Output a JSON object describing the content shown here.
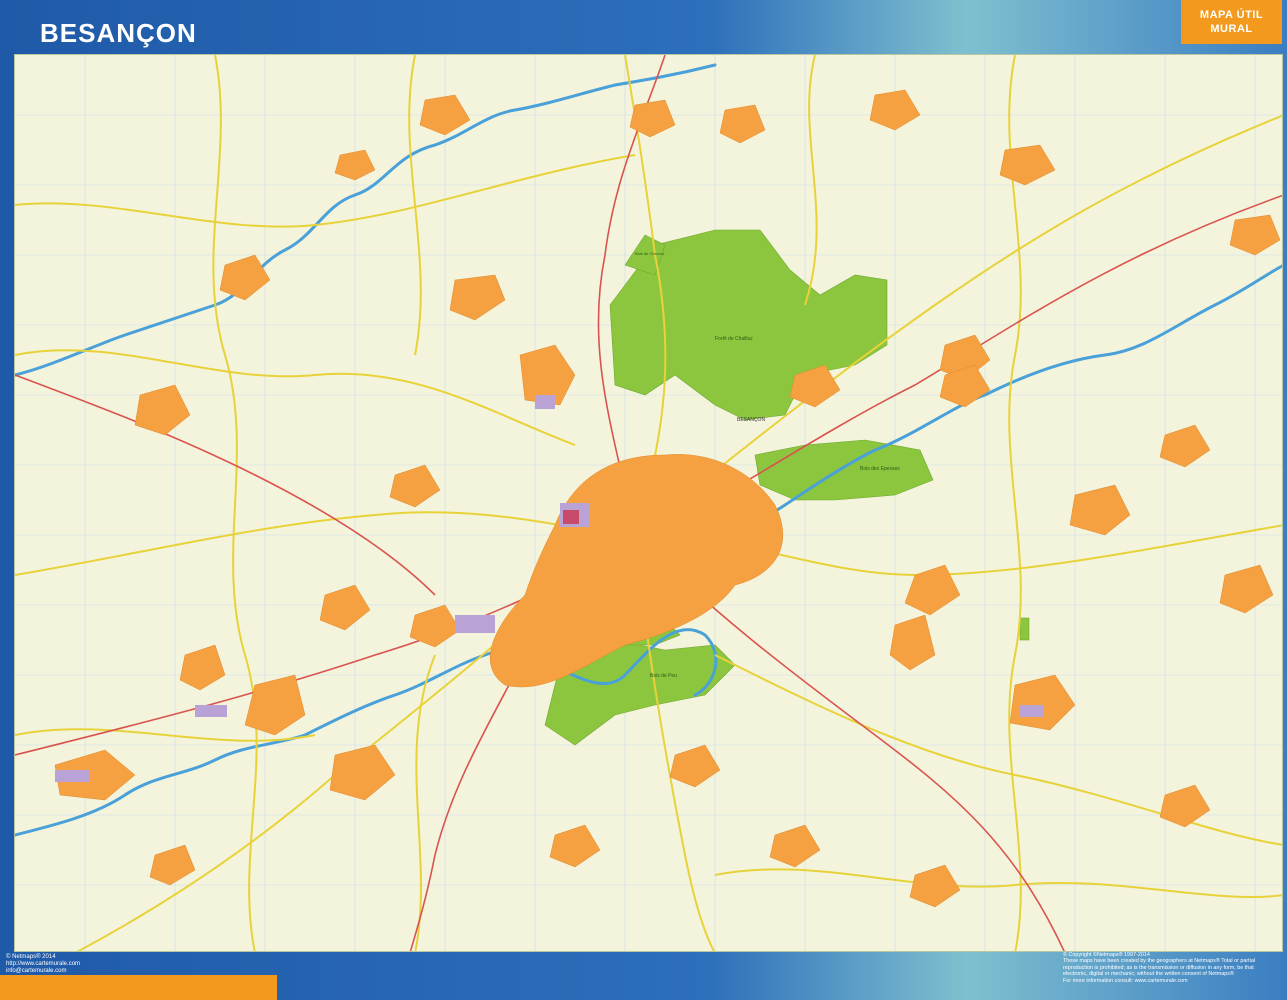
{
  "header": {
    "title": "BESANÇON"
  },
  "badge": {
    "line1": "MAPA ÚTIL",
    "line2": "MURAL"
  },
  "map": {
    "colors": {
      "background": "#f4f4dc",
      "urban": "#f5a142",
      "forest": "#8cc63f",
      "river": "#4aa0d8",
      "river_fill": "#cfe8f6",
      "main_road": "#e8d23a",
      "motorway": "#d9534f",
      "industrial": "#b9a3d6",
      "grid": "#b8d0e6"
    },
    "labels": {
      "forest_north": "Forêt de Chailluz",
      "forest_east": "Bois des Epesses",
      "forest_south": "Bois de Peu",
      "forest_nw": "Bois de Chevroz",
      "city": "BESANÇON"
    }
  },
  "footer": {
    "left": [
      "© Netmaps® 2014",
      "http://www.cartemurale.com",
      "info@cartemurale.com"
    ],
    "right": [
      "© Copyright ©Netmaps® 1997-2014",
      "These maps have been created by the geographers at Netmaps® Total or partial",
      "reproduction is prohibited; as is the transmission or diffusion in any form, be that",
      "electronic, digital or mechanic; without the written consent of Netmaps®",
      "For more information consult: www.cartemurale.com"
    ]
  }
}
